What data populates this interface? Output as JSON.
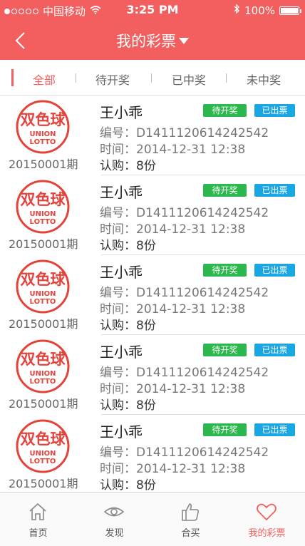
{
  "status": {
    "carrier": "中国移动",
    "time": "3:25 PM",
    "battery": "100%"
  },
  "nav": {
    "title": "我的彩票"
  },
  "tabs": [
    {
      "label": "全部"
    },
    {
      "label": "待开奖"
    },
    {
      "label": "已中奖"
    },
    {
      "label": "未中奖"
    }
  ],
  "logo_text": {
    "line1": "双色球",
    "line2": "UNION",
    "line3": "LOTTO"
  },
  "tickets": [
    {
      "period": "20150001期",
      "name": "王小乖",
      "status1": "待开奖",
      "status2": "已出票",
      "id": "编号：D1411120614242542",
      "time": "时间：2014-12-31 12:38",
      "qty": "认购：8份"
    },
    {
      "period": "20150001期",
      "name": "王小乖",
      "status1": "待开奖",
      "status2": "已出票",
      "id": "编号：D1411120614242542",
      "time": "时间：2014-12-31 12:38",
      "qty": "认购：8份"
    },
    {
      "period": "20150001期",
      "name": "王小乖",
      "status1": "待开奖",
      "status2": "已出票",
      "id": "编号：D1411120614242542",
      "time": "时间：2014-12-31 12:38",
      "qty": "认购：8份"
    },
    {
      "period": "20150001期",
      "name": "王小乖",
      "status1": "待开奖",
      "status2": "已出票",
      "id": "编号：D1411120614242542",
      "time": "时间：2014-12-31 12:38",
      "qty": "认购：8份"
    },
    {
      "period": "20150001期",
      "name": "王小乖",
      "status1": "待开奖",
      "status2": "已出票",
      "id": "编号：D1411120614242542",
      "time": "时间：2014-12-31 12:38",
      "qty": "认购：8份"
    }
  ],
  "tabbar": [
    {
      "label": "首页",
      "icon": "home-icon"
    },
    {
      "label": "发现",
      "icon": "eye-icon"
    },
    {
      "label": "合买",
      "icon": "thumbs-up-icon"
    },
    {
      "label": "我的彩票",
      "icon": "heart-icon"
    }
  ],
  "colors": {
    "brand": "#f35f5f",
    "pending": "#2db84f",
    "issued": "#1aa5e3"
  }
}
